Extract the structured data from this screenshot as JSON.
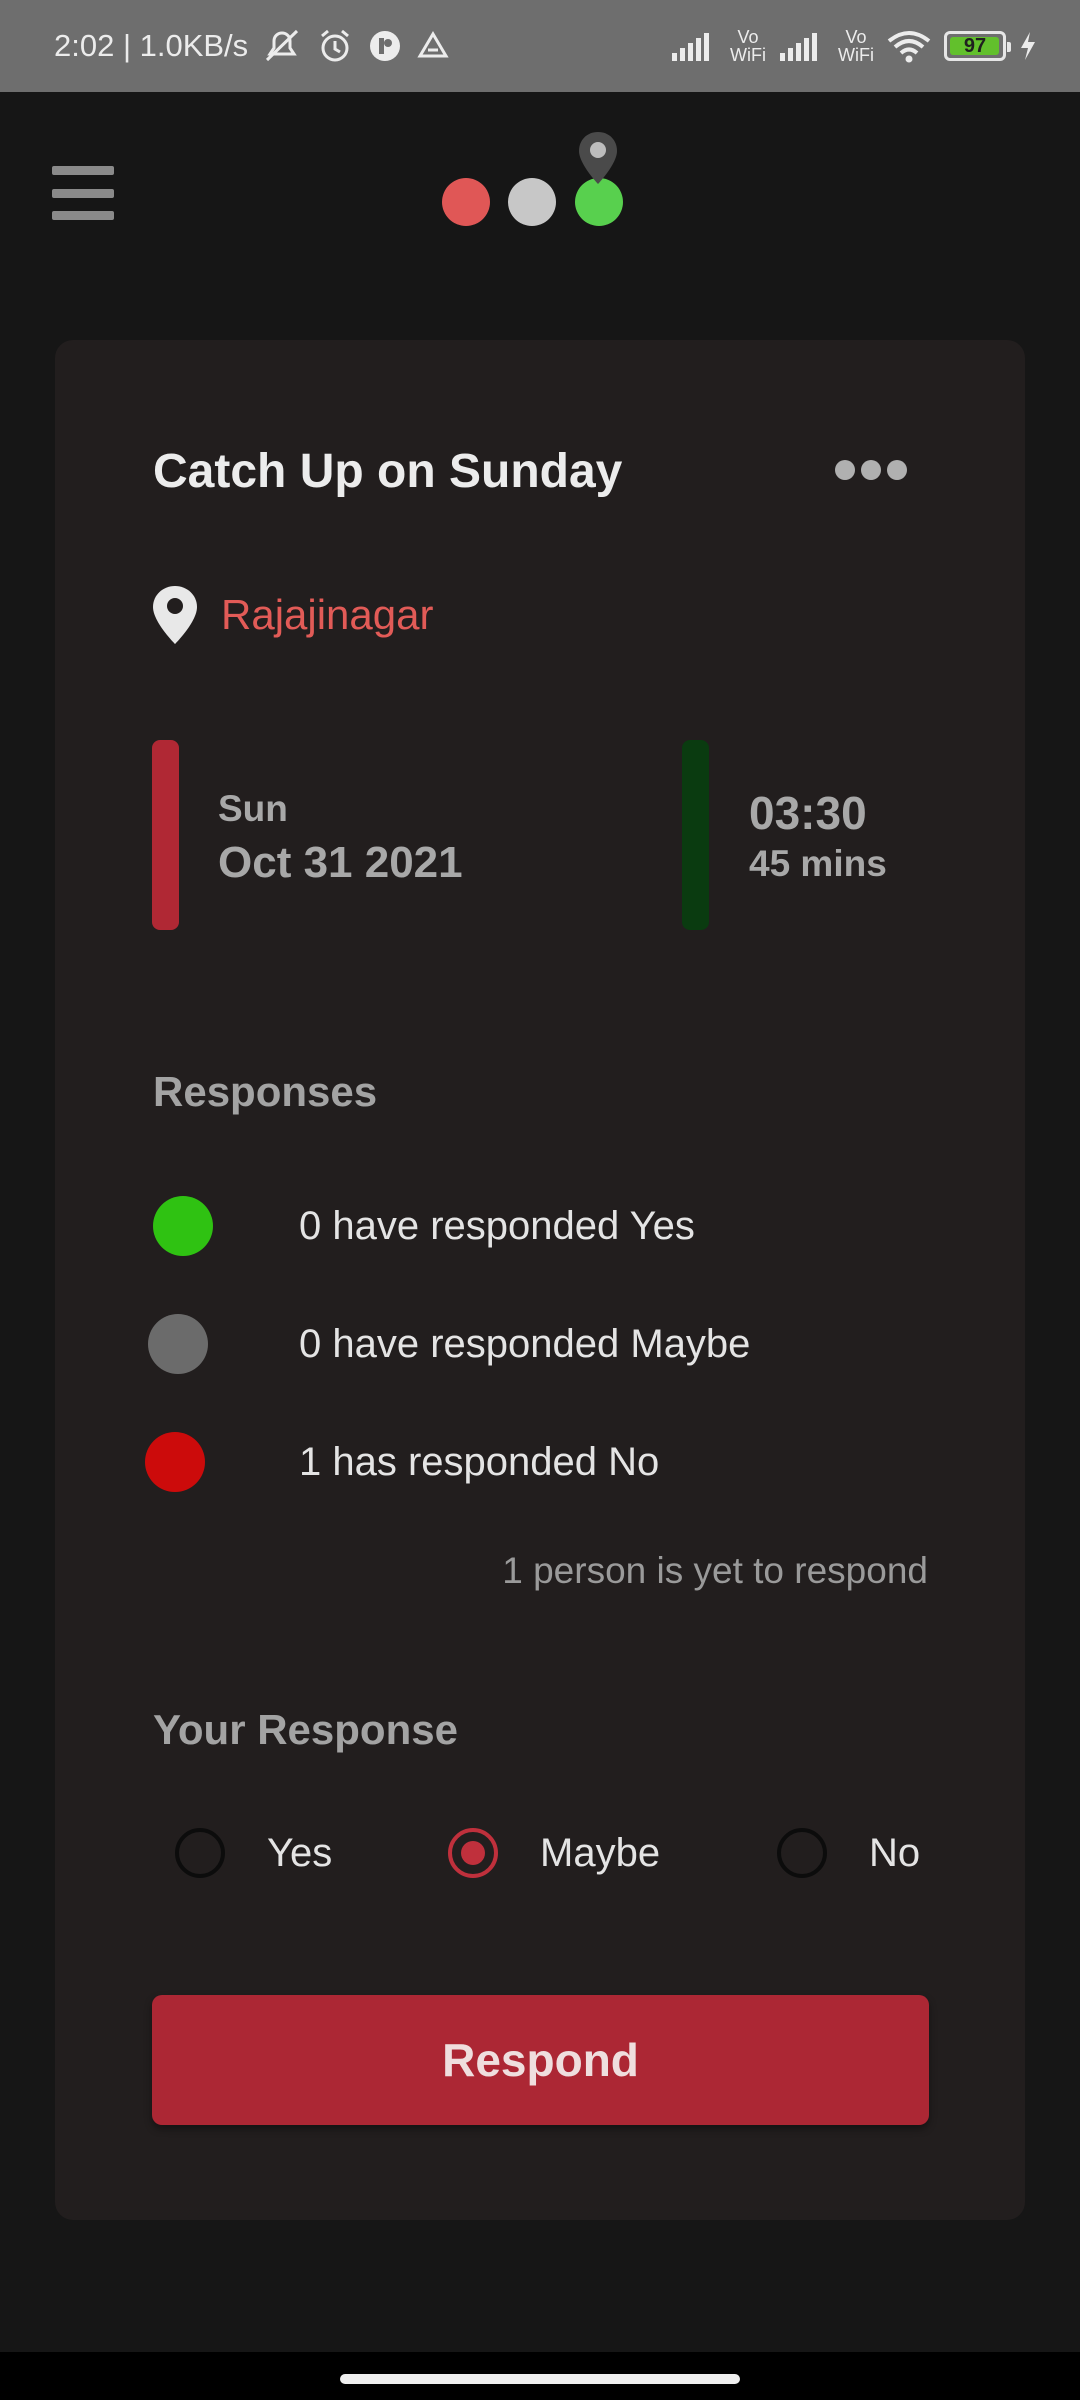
{
  "status_bar": {
    "time_speed": "2:02 | 1.0KB/s",
    "battery": "97",
    "vo_wifi_1": "Vo\nWiFi",
    "vo_wifi_2": "Vo\nWiFi"
  },
  "header": {
    "menu_icon": "hamburger-menu-icon",
    "logo_colors": [
      "#e05756",
      "#c7c7c7",
      "#58d04e"
    ]
  },
  "event": {
    "title": "Catch Up on Sunday",
    "location": "Rajajinagar",
    "day": "Sun",
    "date": "Oct 31 2021",
    "time": "03:30",
    "duration": "45 mins"
  },
  "responses": {
    "heading": "Responses",
    "items": [
      {
        "text": "0 have responded Yes",
        "color": "#2fc212"
      },
      {
        "text": "0 have responded Maybe",
        "color": "#6b6b6b"
      },
      {
        "text": "1 has responded No",
        "color": "#cc0b0b"
      }
    ],
    "pending": "1 person is yet to respond"
  },
  "your_response": {
    "heading": "Your Response",
    "options": [
      {
        "label": "Yes",
        "checked": false
      },
      {
        "label": "Maybe",
        "checked": true
      },
      {
        "label": "No",
        "checked": false
      }
    ],
    "button": "Respond"
  },
  "colors": {
    "accent": "#ac2734",
    "location_text": "#e25b57",
    "date_bar": "#b02834",
    "time_bar": "#0a3b10"
  }
}
